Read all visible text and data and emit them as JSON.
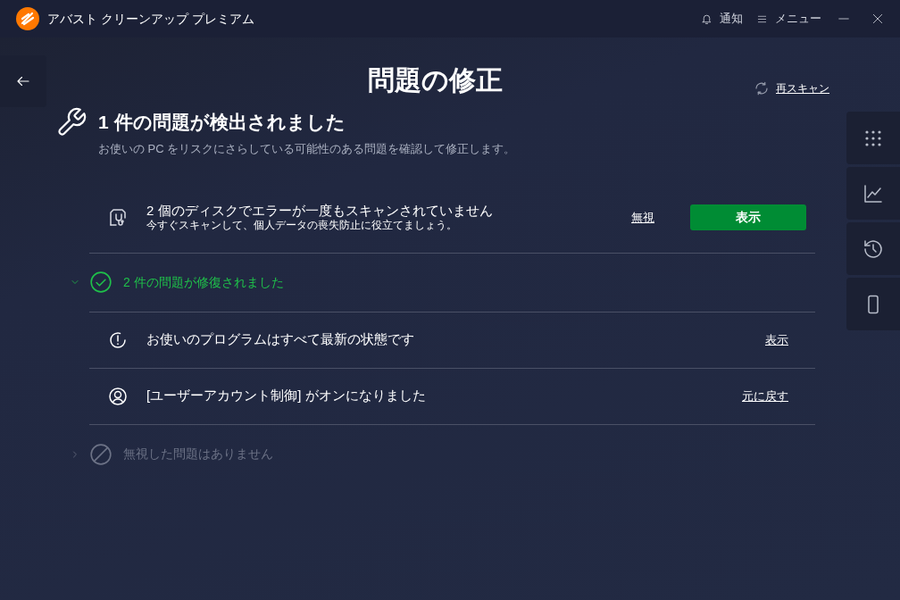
{
  "window": {
    "title": "アバスト クリーンアップ プレミアム",
    "notifications": "通知",
    "menu": "メニュー"
  },
  "page": {
    "title": "問題の修正",
    "rescan": "再スキャン"
  },
  "summary": {
    "heading": "1 件の問題が検出されました",
    "description": "お使いの PC をリスクにさらしている可能性のある問題を確認して修正します。"
  },
  "detected_items": [
    {
      "title": "2 個のディスクでエラーが一度もスキャンされていません",
      "subtitle": "今すぐスキャンして、個人データの喪失防止に役立てましょう。",
      "ignore": "無視",
      "action": "表示"
    }
  ],
  "groups": [
    {
      "kind": "fixed",
      "label": "2 件の問題が修復されました",
      "expanded": true,
      "items": [
        {
          "kind": "update",
          "text": "お使いのプログラムはすべて最新の状態です",
          "action": "表示"
        },
        {
          "kind": "account",
          "text": "[ユーザーアカウント制御] がオンになりました",
          "action": "元に戻す"
        }
      ]
    },
    {
      "kind": "ignored",
      "label": "無視した問題はありません",
      "expanded": false
    }
  ]
}
